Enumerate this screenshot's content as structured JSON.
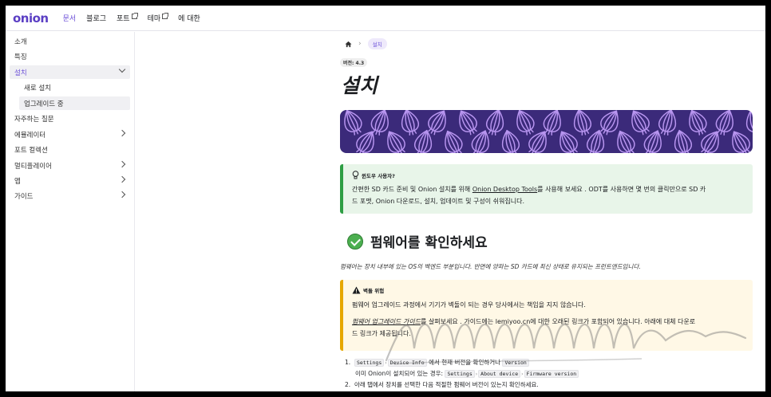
{
  "navbar": {
    "logo": "onion",
    "links": [
      {
        "label": "문서",
        "active": true,
        "external": false
      },
      {
        "label": "블로그",
        "active": false,
        "external": false
      },
      {
        "label": "포트",
        "active": false,
        "external": true
      },
      {
        "label": "테마",
        "active": false,
        "external": true
      },
      {
        "label": "에 대한",
        "active": false,
        "external": false
      }
    ]
  },
  "sidebar": {
    "items": [
      {
        "label": "소개"
      },
      {
        "label": "특징"
      },
      {
        "label": "설치"
      },
      {
        "label": "새로 설치"
      },
      {
        "label": "업그레이드 중"
      },
      {
        "label": "자주하는 질문"
      },
      {
        "label": "에뮬레이터"
      },
      {
        "label": "포트 컬렉션"
      },
      {
        "label": "멀티플레이어"
      },
      {
        "label": "앱"
      },
      {
        "label": "가이드"
      }
    ]
  },
  "breadcrumb": {
    "current": "설치"
  },
  "version_badge": "버전: 4.3",
  "title": "설치",
  "tip": {
    "heading": "윈도우 사용자?",
    "line1_pre": "간편한 SD 카드 준비 및 Onion 설치를 위해 ",
    "link": "Onion Desktop Tools",
    "line1_post": "를 사용해 보세요 . ODT를 사용하면 몇 번의 클릭만으로 SD 카",
    "line2": "드 포맷, Onion 다운로드, 설치, 업데이트 및 구성이 쉬워집니다."
  },
  "section": {
    "heading": "펌웨어를 확인하세요",
    "lead": "펌웨어는 장치 내부에 있는 OS의 백엔드 부분입니다. 반면에 양파는 SD 카드에 최신 상태로 유지되는 프런트엔드입니다."
  },
  "warning": {
    "heading": "벽돌 위험",
    "line1": "펌웨어 업그레이드 과정에서 기기가 벽돌이 되는 경우 당사에서는 책임을 지지 않습니다.",
    "link": "펌웨어 업그레이드 가이드",
    "line2_post": "를 살펴보세요 . 가이드에는 lemiyoo.cn에 대한 오래된 링크가 포함되어 있습니다. 아래에 대체 다운로",
    "line3": "드 링크가 제공됩니다."
  },
  "steps": {
    "step1_a": "Settings",
    "step1_b": "Device Info",
    "step1_text": "에서 현재 버전을 확인하거나",
    "step1_c": "Version",
    "step1_line2": "이미 Onion이 설치되어 있는 경우:",
    "step1_d": "Settings",
    "step1_e": "About device",
    "step1_f": "Firmware version",
    "step2": "아래 탭에서 장치를 선택한 다음 적절한 펌웨어 버전이 있는지 확인하세요."
  },
  "colors": {
    "brand": "#5b3fc4",
    "accent": "#6b4fd8",
    "tip": "#2e9e44",
    "warn": "#e6a700"
  }
}
